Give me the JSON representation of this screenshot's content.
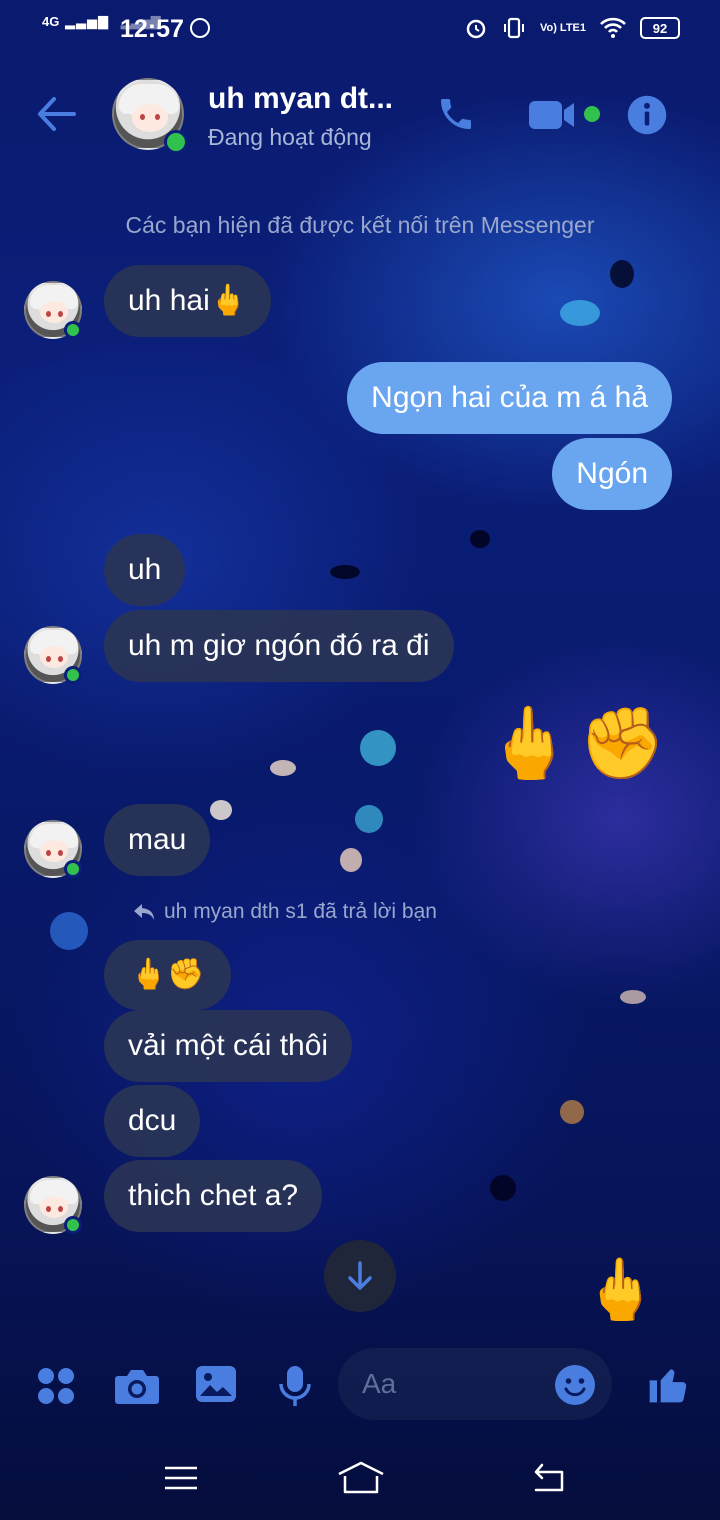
{
  "status_bar": {
    "network": "4G",
    "time": "12:57",
    "volte": "Vo) LTE1",
    "battery": "92"
  },
  "header": {
    "name": "uh myan dt...",
    "status": "Đang hoạt động"
  },
  "system_notice": "Các bạn hiện đã được kết nối trên Messenger",
  "messages": [
    {
      "text": "uh hai🖕",
      "dir": "in"
    },
    {
      "text": "Ngọn hai của m á hả",
      "dir": "out"
    },
    {
      "text": "Ngón",
      "dir": "out"
    },
    {
      "text": "uh",
      "dir": "in"
    },
    {
      "text": "uh m giơ ngón đó ra đi",
      "dir": "in"
    },
    {
      "text": "🖕✊",
      "dir": "out"
    },
    {
      "text": "mau",
      "dir": "in"
    },
    {
      "text": "🖕✊",
      "dir": "in"
    },
    {
      "text": "vải một cái thôi",
      "dir": "in"
    },
    {
      "text": "dcu",
      "dir": "in"
    },
    {
      "text": "thich chet a?",
      "dir": "in"
    },
    {
      "text": "🖕",
      "dir": "out"
    }
  ],
  "reply_notice": "uh myan dth s1 đã trả lời bạn",
  "composer": {
    "placeholder": "Aa"
  },
  "icons": {
    "back": "arrow-left-icon",
    "call": "phone-icon",
    "video": "video-camera-icon",
    "info": "info-icon",
    "menu": "four-dots-icon",
    "camera": "camera-icon",
    "gallery": "image-icon",
    "mic": "microphone-icon",
    "emoji": "smiley-icon",
    "like": "thumbs-up-icon",
    "scroll": "arrow-down-icon"
  },
  "colors": {
    "accent": "#3d6fd8",
    "outgoing_bubble": "#6aa6f0",
    "incoming_bubble": "#2a3456",
    "online": "#31c24d"
  }
}
